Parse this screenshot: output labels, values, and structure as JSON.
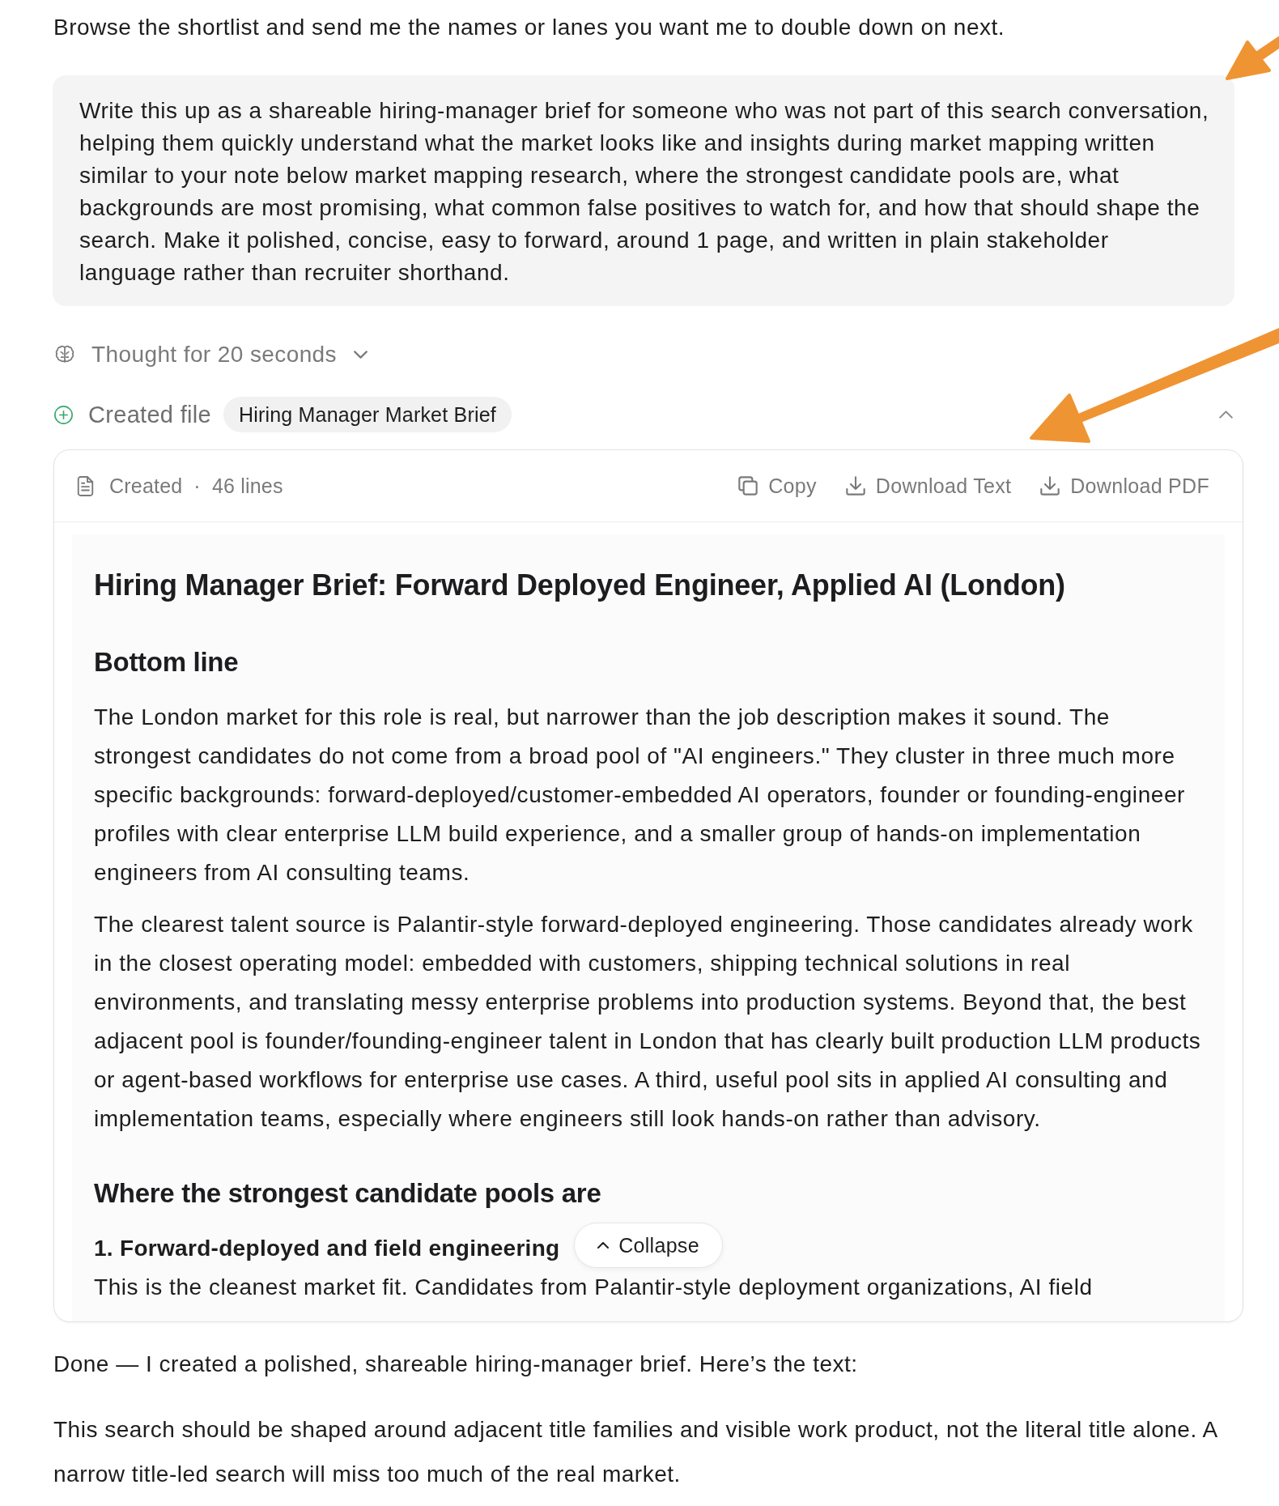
{
  "intro_message": {
    "text": "Browse the shortlist and send me the names or lanes you want me to double down on next."
  },
  "user_message": {
    "text": "Write this up as a shareable hiring-manager brief for someone who was not part of this search conversation, helping them quickly understand what the market looks like and insights during market mapping written similar to your note below market mapping research, where the strongest candidate pools are, what backgrounds are most promising, what common false positives to watch for, and how that should shape the search. Make it polished, concise, easy to forward, around 1 page, and written in plain stakeholder language rather than recruiter shorthand."
  },
  "thought": {
    "label": "Thought for 20 seconds",
    "expanded": false
  },
  "created_file": {
    "label": "Created file",
    "file_name": "Hiring Manager Market Brief",
    "expanded": true,
    "card": {
      "status": "Created",
      "separator": "·",
      "line_count": "46 lines",
      "actions": [
        {
          "kind": "copy",
          "label": "Copy"
        },
        {
          "kind": "download",
          "label": "Download Text"
        },
        {
          "kind": "download",
          "label": "Download PDF"
        }
      ],
      "document": [
        {
          "kind": "title",
          "text": "Hiring Manager Brief: Forward Deployed Engineer, Applied AI (London)"
        },
        {
          "kind": "heading",
          "text": "Bottom line"
        },
        {
          "kind": "paragraph",
          "text": "The London market for this role is real, but narrower than the job description makes it sound. The strongest candidates do not come from a broad pool of \"AI engineers.\" They cluster in three much more specific backgrounds: forward-deployed/customer-embedded AI operators, founder or founding-engineer profiles with clear enterprise LLM build experience, and a smaller group of hands-on implementation engineers from AI consulting teams."
        },
        {
          "kind": "paragraph",
          "text": "The clearest talent source is Palantir-style forward-deployed engineering. Those candidates already work in the closest operating model: embedded with customers, shipping technical solutions in real environments, and translating messy enterprise problems into production systems. Beyond that, the best adjacent pool is founder/founding-engineer talent in London that has clearly built production LLM products or agent-based workflows for enterprise use cases. A third, useful pool sits in applied AI consulting and implementation teams, especially where engineers still look hands-on rather than advisory."
        },
        {
          "kind": "heading",
          "text": "Where the strongest candidate pools are"
        },
        {
          "kind": "subheading",
          "text": "1. Forward-deployed and field engineering"
        },
        {
          "kind": "paragraph",
          "text": "This is the cleanest market fit. Candidates from Palantir-style deployment organizations, AI field"
        }
      ],
      "collapse_button": {
        "label": "Collapse"
      }
    }
  },
  "assistant_reply": [
    "Done — I created a polished, shareable hiring-manager brief. Here’s the text:",
    "This search should be shaped around adjacent title families and visible work product, not the literal title alone. A narrow title-led search will miss too much of the real market."
  ]
}
